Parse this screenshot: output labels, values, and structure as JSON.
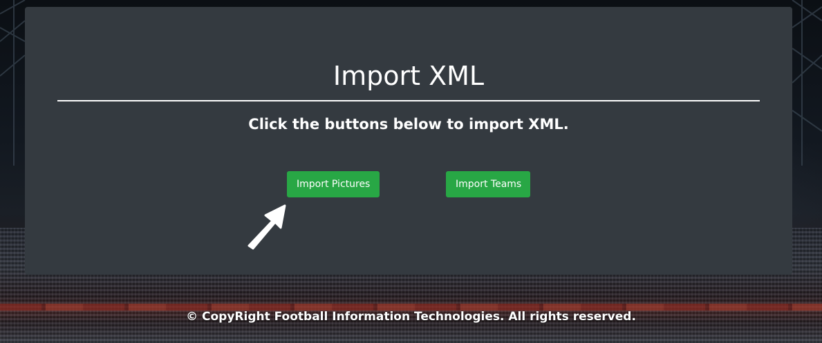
{
  "page": {
    "title": "Import XML",
    "subtitle": "Click the buttons below to import XML."
  },
  "buttons": {
    "import_pictures_label": "Import Pictures",
    "import_teams_label": "Import Teams"
  },
  "footer": {
    "copyright": "© CopyRight Football Information Technologies. All rights reserved."
  },
  "icons": {
    "pointer": "arrow-pointer-icon"
  },
  "colors": {
    "panel": "#343a40",
    "button_success": "#28a745",
    "text": "#ffffff"
  }
}
